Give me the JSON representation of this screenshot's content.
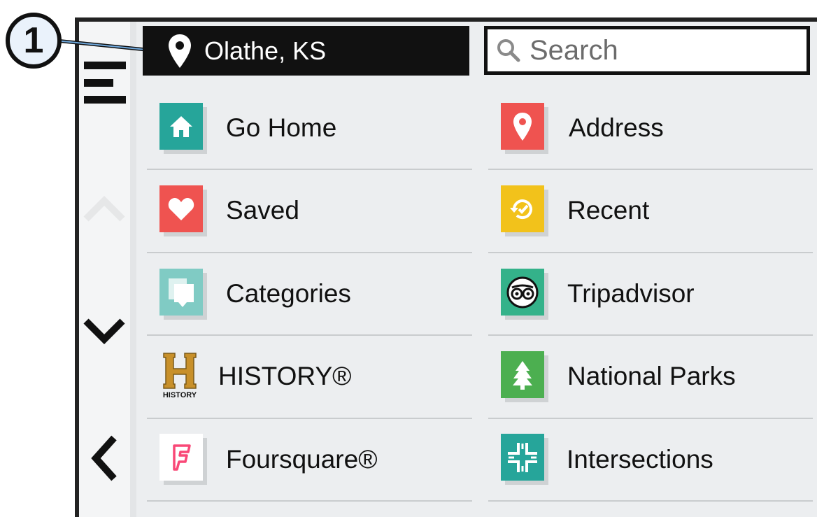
{
  "callout": {
    "number": "1"
  },
  "location": {
    "label": "Olathe, KS"
  },
  "search": {
    "placeholder": "Search"
  },
  "left_items": [
    {
      "label": "Go Home",
      "color": "#26a59a"
    },
    {
      "label": "Saved",
      "color": "#ef5350"
    },
    {
      "label": "Categories",
      "color": "#80cbc4"
    },
    {
      "label": "HISTORY®",
      "color": "#c8902a",
      "logo_text": "HISTORY"
    },
    {
      "label": "Foursquare®",
      "color": "#f94877"
    }
  ],
  "right_items": [
    {
      "label": "Address",
      "color": "#ef5350"
    },
    {
      "label": "Recent",
      "color": "#f2c21b"
    },
    {
      "label": "Tripadvisor",
      "color": "#34b28a"
    },
    {
      "label": "National Parks",
      "color": "#4caf50"
    },
    {
      "label": "Intersections",
      "color": "#26a59a"
    }
  ],
  "nav_icons": [
    "menu-icon",
    "scroll-up-icon",
    "scroll-down-icon",
    "back-icon"
  ]
}
